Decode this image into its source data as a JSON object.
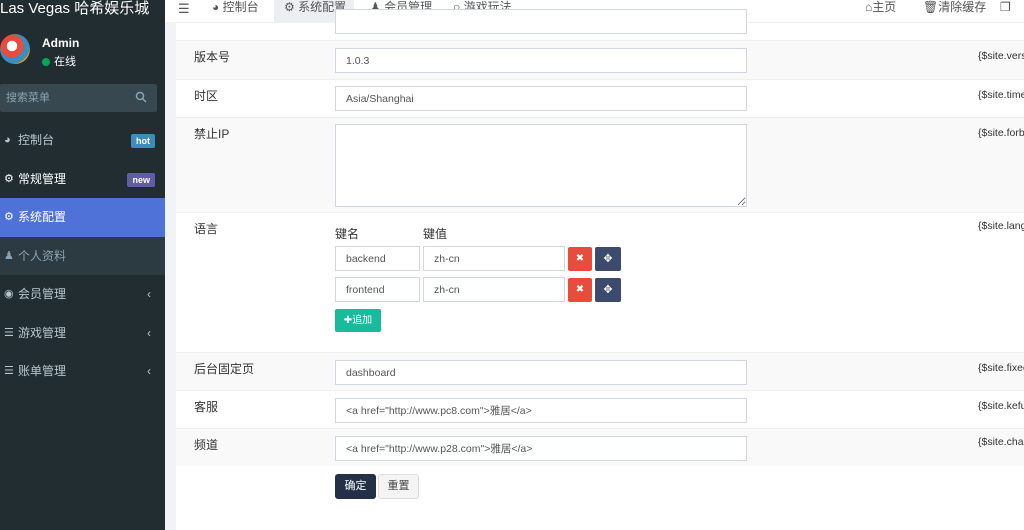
{
  "brand": "Las Vegas 哈希娱乐城",
  "user": {
    "name": "Admin",
    "status": "在线"
  },
  "search": {
    "placeholder": "搜索菜单"
  },
  "menu": [
    {
      "label": "控制台",
      "icon": "dashboard-icon",
      "badge": "hot"
    },
    {
      "label": "常规管理",
      "icon": "cogs-icon",
      "badge": "new"
    },
    {
      "label": "系统配置",
      "icon": "gear-icon"
    },
    {
      "label": "个人资料",
      "icon": "user-icon"
    },
    {
      "label": "会员管理",
      "icon": "user-circle-icon"
    },
    {
      "label": "游戏管理",
      "icon": "list-icon"
    },
    {
      "label": "账单管理",
      "icon": "list-icon"
    }
  ],
  "header": {
    "tabs": [
      "控制台",
      "系统配置",
      "会员管理",
      "游戏玩法"
    ],
    "home": "主页",
    "clear_cache": "清除缓存"
  },
  "form": {
    "version": {
      "label": "版本号",
      "value": "1.0.3",
      "var": "{$site.version}"
    },
    "timezone": {
      "label": "时区",
      "value": "Asia/Shanghai",
      "var": "{$site.timezone}"
    },
    "forbiddenip": {
      "label": "禁止IP",
      "value": "",
      "var": "{$site.forbiddenip}"
    },
    "languages": {
      "label": "语言",
      "key_header": "键名",
      "value_header": "键值",
      "rows": [
        {
          "key": "backend",
          "value": "zh-cn"
        },
        {
          "key": "frontend",
          "value": "zh-cn"
        }
      ],
      "add_label": "追加",
      "var": "{$site.languages}"
    },
    "fixedpage": {
      "label": "后台固定页",
      "value": "dashboard",
      "var": "{$site.fixedpage}"
    },
    "kefu": {
      "label": "客服",
      "value": "<a href=\"http://www.pc8.com\">雅居</a>",
      "var": "{$site.kefu}"
    },
    "channel": {
      "label": "频道",
      "value": "<a href=\"http://www.p28.com\">雅居</a>",
      "var": "{$site.channel}"
    },
    "submit_label": "确定",
    "reset_label": "重置"
  },
  "colors": {
    "sidebar": "#222d32",
    "active_menu": "#4f72d8",
    "danger": "#e74c3c",
    "success": "#18bc9c",
    "badge_hot": "#3c8dbc",
    "badge_new": "#605ca8"
  }
}
